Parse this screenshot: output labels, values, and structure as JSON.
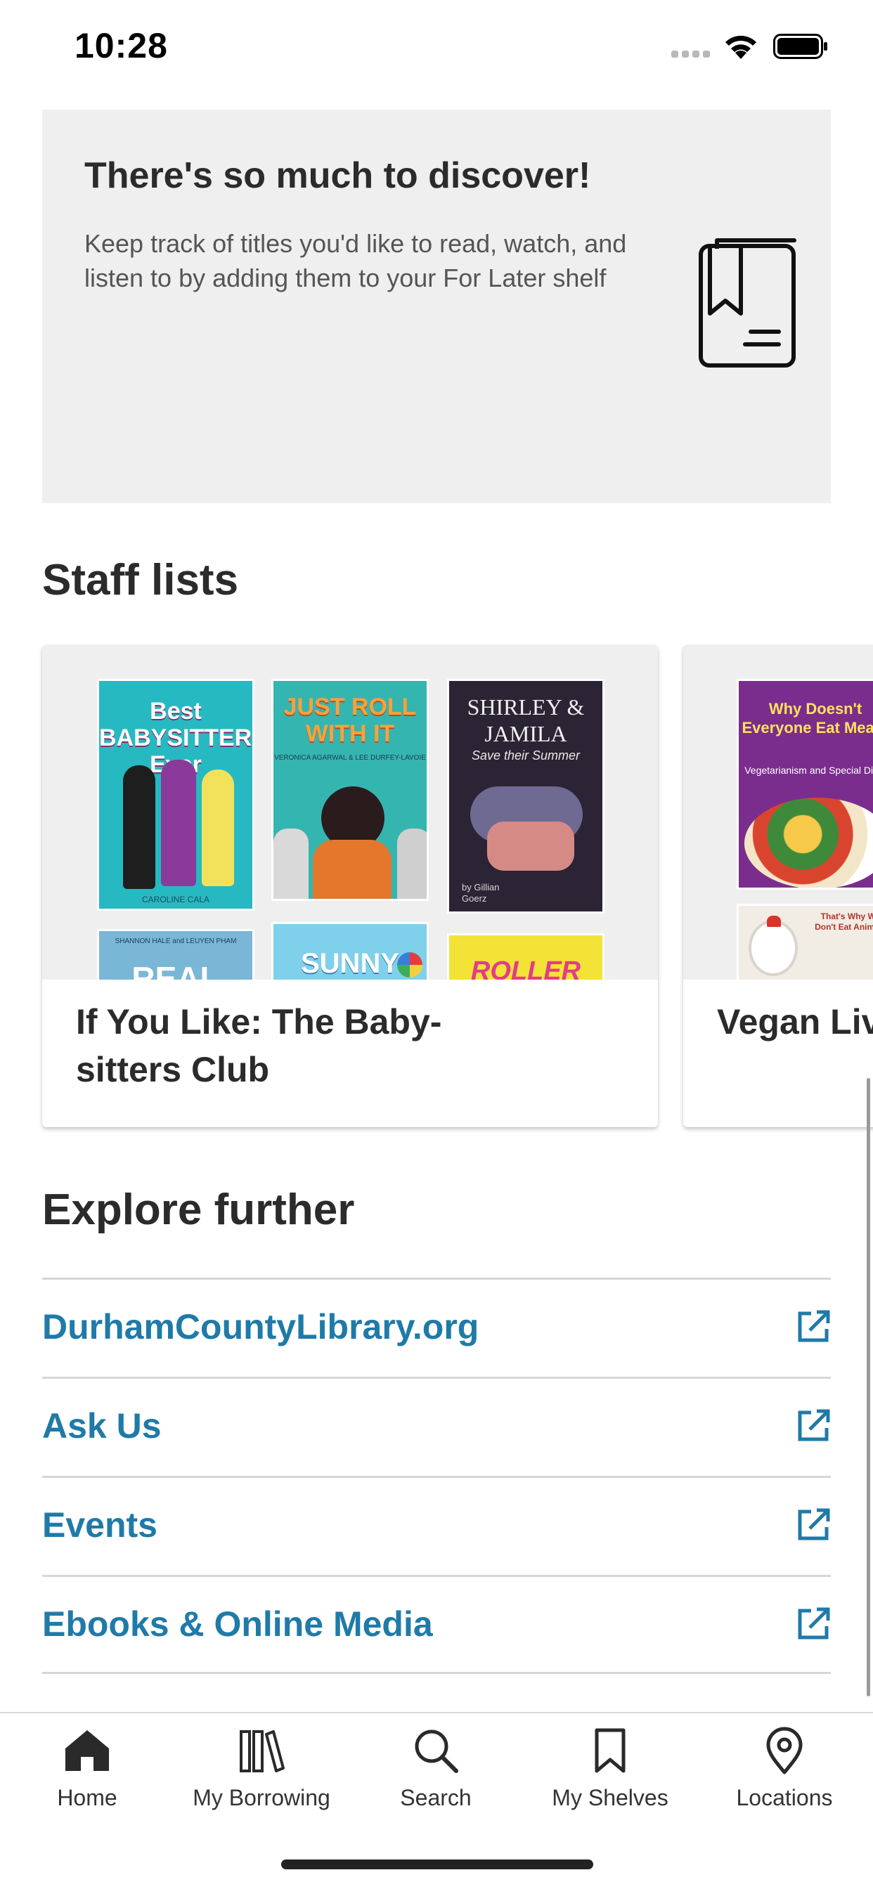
{
  "status_bar": {
    "time": "10:28"
  },
  "discover": {
    "title": "There's so much to discover!",
    "body": "Keep track of titles you'd like to read, watch, and listen to by adding them to your For Later shelf"
  },
  "staff_lists": {
    "heading": "Staff lists",
    "cards": [
      {
        "label": "If You Like: The Baby-sitters Club",
        "covers": [
          {
            "title": "Best BABYSITTERS Ever",
            "author": "CAROLINE CALA"
          },
          {
            "title": "JUST ROLL WITH IT",
            "author": "VERONICA AGARWAL & LEE DURFEY-LAVOIE"
          },
          {
            "title": "SHIRLEY & JAMILA",
            "subtitle": "Save their Summer",
            "author": "by Gillian Goerz"
          },
          {
            "title": "REAL",
            "author": "SHANNON HALE and LEUYEN PHAM"
          },
          {
            "title": "SUNNY"
          },
          {
            "title": "ROLLER GIRL"
          }
        ]
      },
      {
        "label": "Vegan Liv",
        "covers": [
          {
            "title": "Why Doesn't Everyone Eat Meat?",
            "subtitle": "Vegetarianism and Special Diets"
          },
          {
            "title": "That's Why We Don't Eat Animals"
          }
        ]
      }
    ]
  },
  "explore": {
    "heading": "Explore further",
    "links": [
      {
        "label": "DurhamCountyLibrary.org"
      },
      {
        "label": "Ask Us"
      },
      {
        "label": "Events"
      },
      {
        "label": "Ebooks & Online Media"
      }
    ]
  },
  "tab_bar": {
    "tabs": [
      {
        "label": "Home",
        "icon": "home-icon"
      },
      {
        "label": "My Borrowing",
        "icon": "books-icon"
      },
      {
        "label": "Search",
        "icon": "search-icon"
      },
      {
        "label": "My Shelves",
        "icon": "bookmark-icon"
      },
      {
        "label": "Locations",
        "icon": "location-pin-icon"
      }
    ]
  },
  "colors": {
    "link": "#1f7aa8",
    "card_background": "#efefef",
    "text": "#2b2b2b"
  }
}
